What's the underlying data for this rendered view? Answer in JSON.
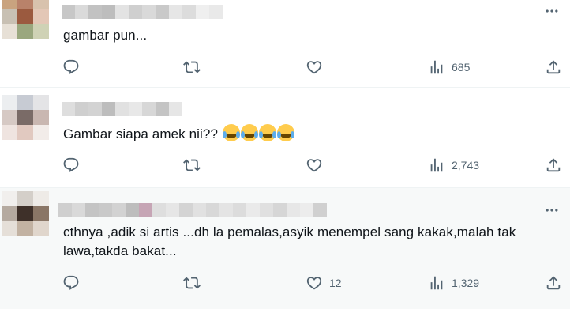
{
  "tweets": [
    {
      "text": "gambar pun...",
      "views": "685",
      "likes": ""
    },
    {
      "text": "Gambar siapa amek nii?? ",
      "views": "2,743",
      "likes": ""
    },
    {
      "text": "cthnya ,adik si artis ...dh la pemalas,asyik menempel sang kakak,malah tak\nlawa,takda bakat...",
      "views": "1,329",
      "likes": "12"
    }
  ],
  "icons": {
    "reply": "reply-icon",
    "retweet": "retweet-icon",
    "like": "heart-icon",
    "views": "views-icon",
    "share": "share-icon",
    "more": "more-icon",
    "emoji": "face-with-tears-of-joy-emoji"
  },
  "colors": {
    "icon_gray": "#536471",
    "text": "#0f1419",
    "divider": "#eff3f4",
    "highlight_bg": "#f7f9f9"
  }
}
